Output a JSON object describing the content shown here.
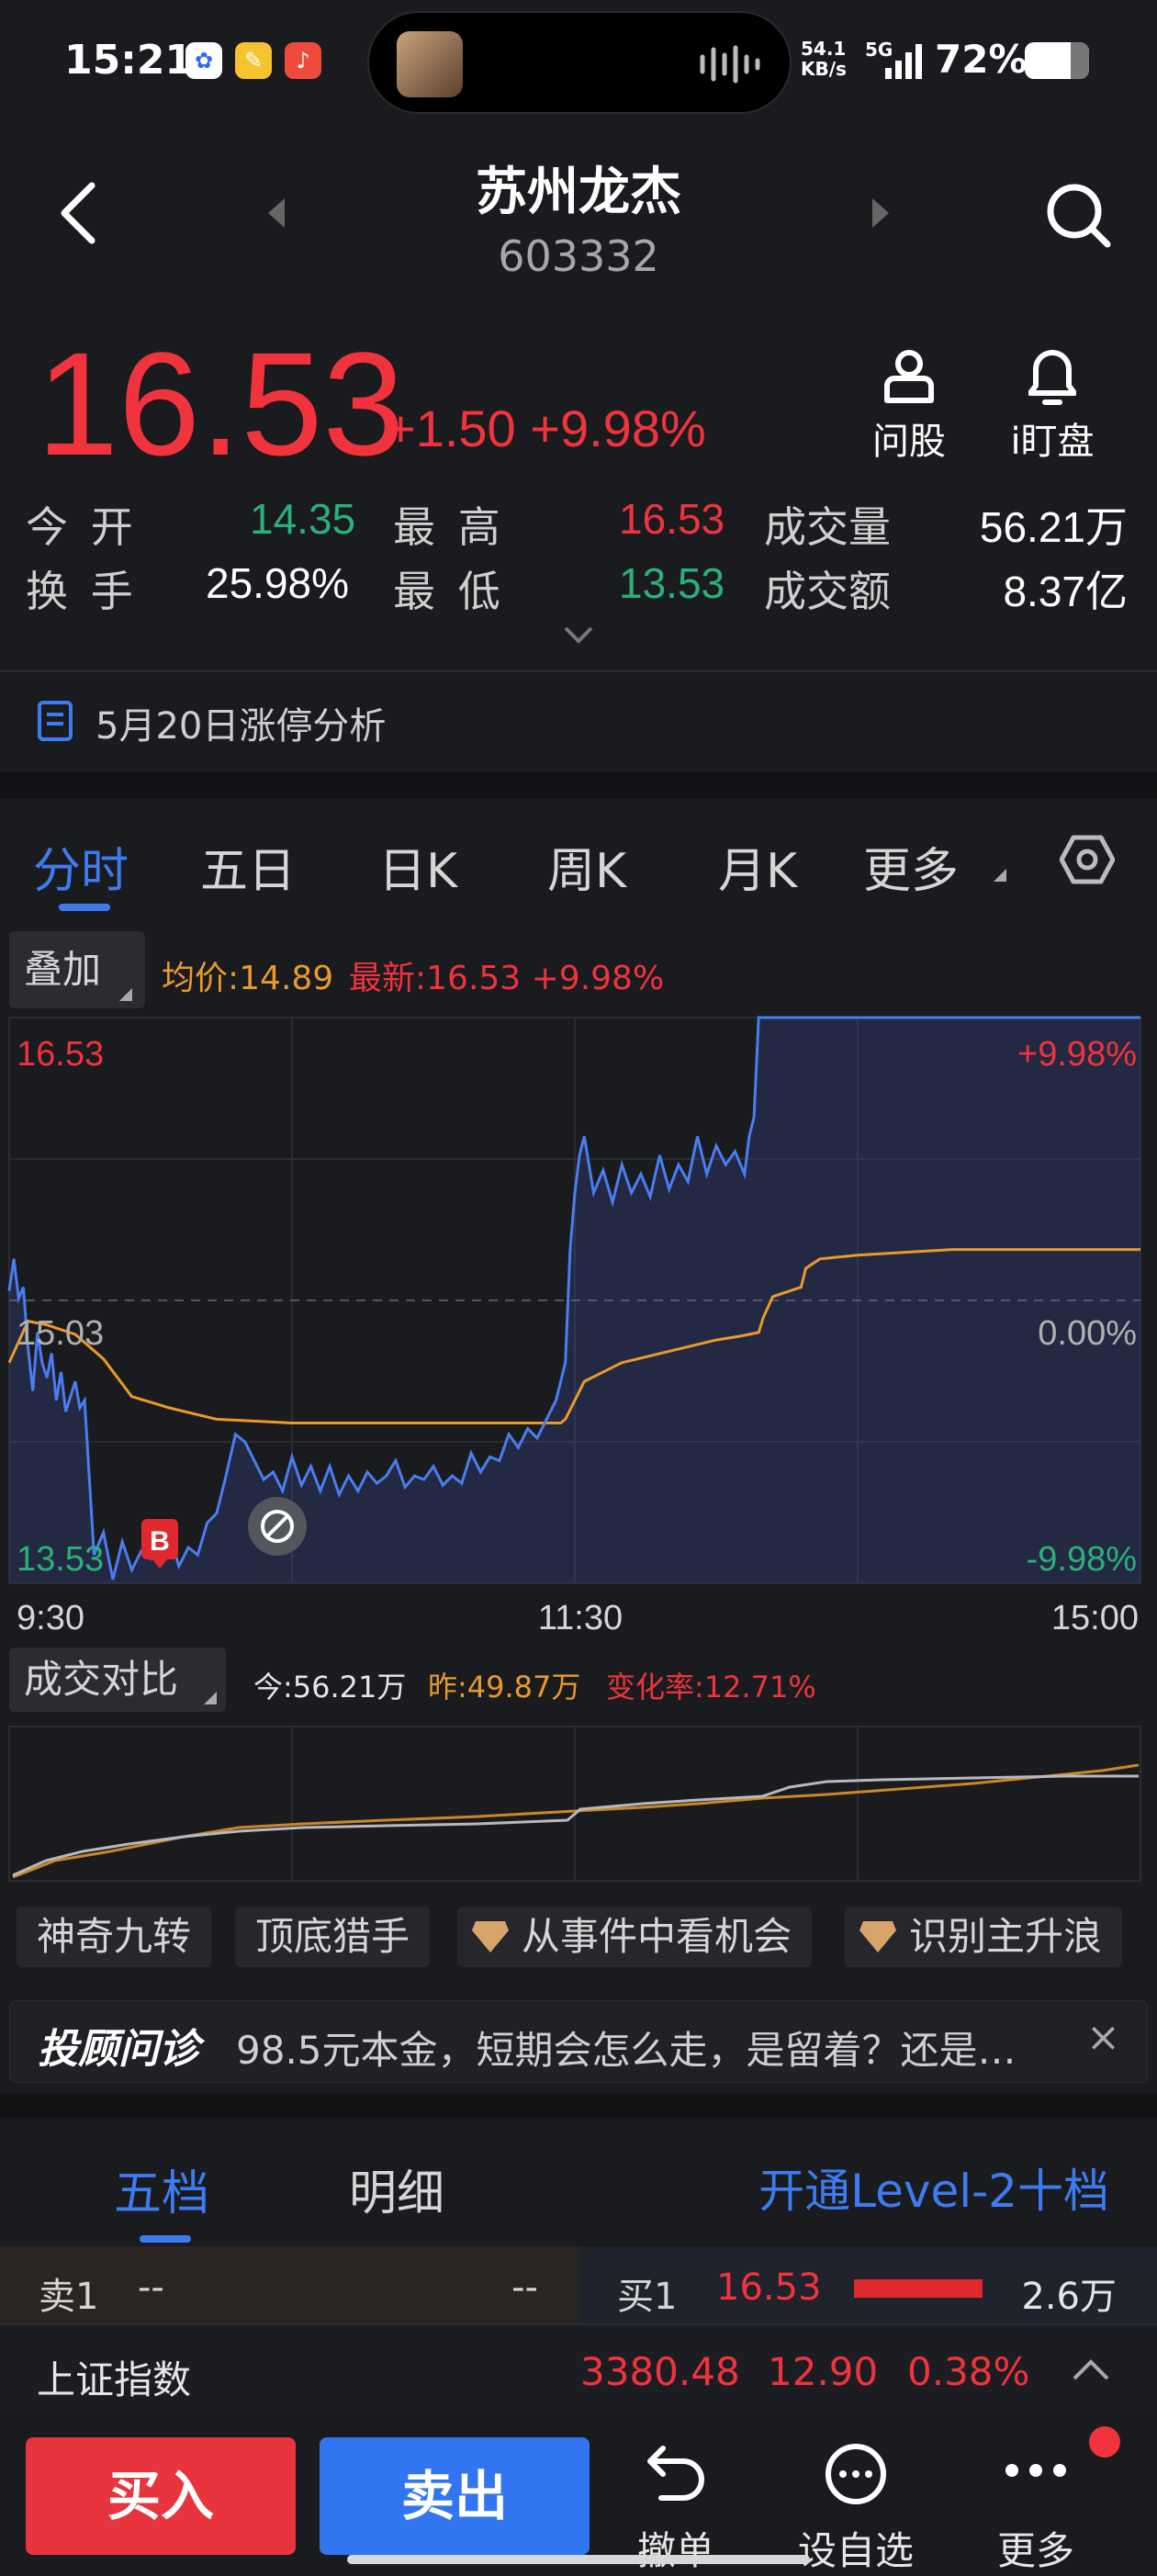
{
  "status_bar": {
    "time": "15:21",
    "network_speed": "54.1",
    "network_unit": "KB/s",
    "network_type": "5G",
    "battery": "72%"
  },
  "header": {
    "stock_name": "苏州龙杰",
    "stock_code": "603332"
  },
  "quote": {
    "price": "16.53",
    "change": "+1.50",
    "change_pct": "+9.98%",
    "ask_label": "问股",
    "watch_label": "i盯盘",
    "open_label": "今  开",
    "open": "14.35",
    "high_label": "最  高",
    "high": "16.53",
    "volume_label": "成交量",
    "volume": "56.21万",
    "turnover_label": "换  手",
    "turnover": "25.98%",
    "low_label": "最  低",
    "low": "13.53",
    "amount_label": "成交额",
    "amount": "8.37亿",
    "notice": "5月20日涨停分析"
  },
  "tabs": [
    "分时",
    "五日",
    "日K",
    "周K",
    "月K",
    "更多"
  ],
  "chart_toolbar": {
    "overlay_label": "叠加",
    "avg_price": "均价:14.89",
    "latest": "最新:16.53 +9.98%"
  },
  "chart_data": {
    "type": "line",
    "x_labels": [
      "9:30",
      "11:30",
      "15:00"
    ],
    "y_left": [
      "16.53",
      "15.03",
      "13.53"
    ],
    "y_right": [
      "+9.98%",
      "0.00%",
      "-9.98%"
    ],
    "ylim": [
      13.53,
      16.53
    ],
    "series": [
      {
        "name": "最新",
        "color": "#4a7df0",
        "x": [
          0,
          1,
          2,
          3,
          4,
          5,
          6,
          7,
          8,
          9,
          10,
          11,
          12,
          14,
          15,
          16,
          18,
          20,
          22,
          24,
          26,
          28,
          30,
          32,
          34,
          36,
          38,
          40,
          42,
          44,
          46,
          48,
          50,
          52,
          54,
          56,
          58,
          60,
          62,
          64,
          66,
          68,
          70,
          72,
          74,
          76,
          78,
          80,
          82,
          84,
          86,
          88,
          90,
          92,
          94,
          96,
          98,
          100,
          102,
          104,
          106,
          108,
          110,
          112,
          114,
          116,
          118,
          119,
          120,
          121,
          122,
          124,
          126,
          128,
          130,
          132,
          134,
          136,
          138,
          140,
          142,
          144,
          146,
          148,
          150,
          152,
          154,
          156,
          157,
          158,
          159,
          160,
          162,
          166,
          170,
          180,
          200,
          220,
          240
        ],
        "y": [
          15.08,
          15.25,
          15.04,
          15.1,
          14.78,
          14.55,
          14.86,
          14.7,
          14.62,
          14.75,
          14.5,
          14.65,
          14.44,
          14.6,
          14.46,
          14.5,
          13.68,
          13.8,
          13.55,
          13.75,
          13.6,
          13.7,
          13.66,
          13.78,
          13.8,
          13.62,
          13.72,
          13.68,
          13.85,
          13.9,
          14.1,
          14.32,
          14.28,
          14.18,
          14.08,
          14.12,
          14.02,
          14.2,
          14.05,
          14.15,
          14.02,
          14.15,
          14.0,
          14.1,
          14.02,
          14.12,
          14.06,
          14.1,
          14.18,
          14.04,
          14.1,
          14.08,
          14.15,
          14.05,
          14.1,
          14.06,
          14.22,
          14.12,
          14.2,
          14.18,
          14.32,
          14.25,
          14.35,
          14.3,
          14.4,
          14.5,
          14.7,
          15.3,
          15.6,
          15.8,
          15.9,
          15.6,
          15.72,
          15.55,
          15.75,
          15.6,
          15.7,
          15.58,
          15.8,
          15.62,
          15.75,
          15.66,
          15.9,
          15.7,
          15.85,
          15.75,
          15.82,
          15.7,
          15.9,
          16.0,
          16.53,
          16.53,
          16.53,
          16.53,
          16.53,
          16.53,
          16.53,
          16.53,
          16.53
        ]
      },
      {
        "name": "均价",
        "color": "#e89a2c",
        "x": [
          0,
          4,
          8,
          14,
          20,
          26,
          34,
          44,
          60,
          80,
          100,
          110,
          117,
          118,
          122,
          130,
          140,
          150,
          155,
          159,
          160,
          162,
          168,
          169,
          172,
          180,
          200,
          220,
          240
        ],
        "y": [
          14.7,
          14.92,
          14.9,
          14.85,
          14.72,
          14.52,
          14.46,
          14.4,
          14.38,
          14.38,
          14.38,
          14.38,
          14.38,
          14.4,
          14.6,
          14.7,
          14.76,
          14.82,
          14.84,
          14.86,
          14.94,
          15.05,
          15.1,
          15.2,
          15.25,
          15.27,
          15.3,
          15.3,
          15.3
        ]
      }
    ]
  },
  "volume_compare": {
    "label": "成交对比",
    "today": "今:56.21万",
    "yesterday": "昨:49.87万",
    "change_rate": "变化率:12.71%"
  },
  "tools": [
    "神奇九转",
    "顶底猎手",
    "从事件中看机会",
    "识别主升浪"
  ],
  "promo": {
    "brand": "投顾问诊",
    "text": "98.5元本金，短期会怎么走，是留着？还是…",
    "close": "×"
  },
  "order_book": {
    "tab_five": "五档",
    "tab_detail": "明细",
    "upgrade": "开通Level-2十档",
    "sell1_label": "卖1",
    "sell1_price": "--",
    "sell1_vol": "--",
    "buy1_label": "买1",
    "buy1_price": "16.53",
    "buy1_vol": "2.6万"
  },
  "index_bar": {
    "name": "上证指数",
    "value": "3380.48",
    "change": "12.90",
    "change_pct": "0.38%"
  },
  "bottom_bar": {
    "buy": "买入",
    "sell": "卖出",
    "cancel": "撤单",
    "set_watch": "设自选",
    "more": "更多"
  }
}
